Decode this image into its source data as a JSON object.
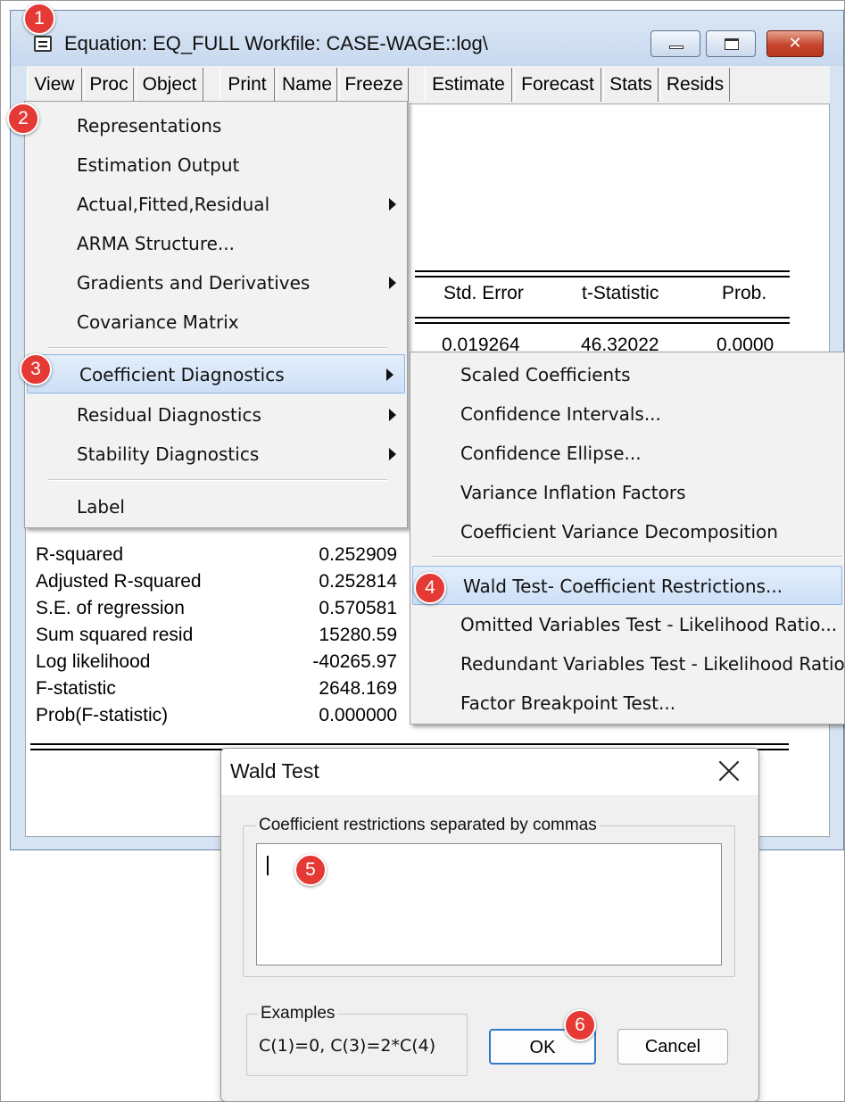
{
  "window": {
    "title": "Equation: EQ_FULL    Workfile: CASE-WAGE::log\\",
    "minimize_glyph": "",
    "maximize_glyph": "",
    "close_glyph": "✕"
  },
  "toolbar": {
    "buttons": [
      "View",
      "Proc",
      "Object",
      "Print",
      "Name",
      "Freeze",
      "Estimate",
      "Forecast",
      "Stats",
      "Resids"
    ]
  },
  "table": {
    "headers": [
      "Std. Error",
      "t-Statistic",
      "Prob."
    ],
    "first_row": [
      "0.019264",
      "46.32022",
      "0.0000"
    ]
  },
  "stats": [
    {
      "label": "R-squared",
      "value": "0.252909"
    },
    {
      "label": "Adjusted R-squared",
      "value": "0.252814"
    },
    {
      "label": "S.E. of regression",
      "value": "0.570581"
    },
    {
      "label": "Sum squared resid",
      "value": "15280.59"
    },
    {
      "label": "Log likelihood",
      "value": "-40265.97"
    },
    {
      "label": "F-statistic",
      "value": "2648.169"
    },
    {
      "label": "Prob(F-statistic)",
      "value": "0.000000"
    }
  ],
  "view_menu": {
    "items": [
      "Representations",
      "Estimation Output",
      "Actual,Fitted,Residual",
      "ARMA Structure...",
      "Gradients and Derivatives",
      "Covariance Matrix",
      "Coefficient Diagnostics",
      "Residual Diagnostics",
      "Stability Diagnostics",
      "Label"
    ]
  },
  "coef_submenu": {
    "items": [
      "Scaled Coefficients",
      "Confidence Intervals...",
      "Confidence Ellipse...",
      "Variance Inflation Factors",
      "Coefficient Variance Decomposition",
      "Wald Test- Coefficient Restrictions...",
      "Omitted Variables Test - Likelihood Ratio...",
      "Redundant Variables Test - Likelihood Ratio...",
      "Factor Breakpoint Test..."
    ]
  },
  "wald_dialog": {
    "title": "Wald Test",
    "group_label": "Coefficient restrictions separated by commas",
    "input_value": "",
    "examples_label": "Examples",
    "examples_text": "C(1)=0,  C(3)=2*C(4)",
    "ok_label": "OK",
    "cancel_label": "Cancel"
  },
  "badges": [
    "1",
    "2",
    "3",
    "4",
    "5",
    "6"
  ],
  "colors": {
    "badge": "#e53935",
    "menu_highlight": "#cde0f7",
    "close_button": "#c6442c",
    "ok_border": "#2f79c9"
  }
}
